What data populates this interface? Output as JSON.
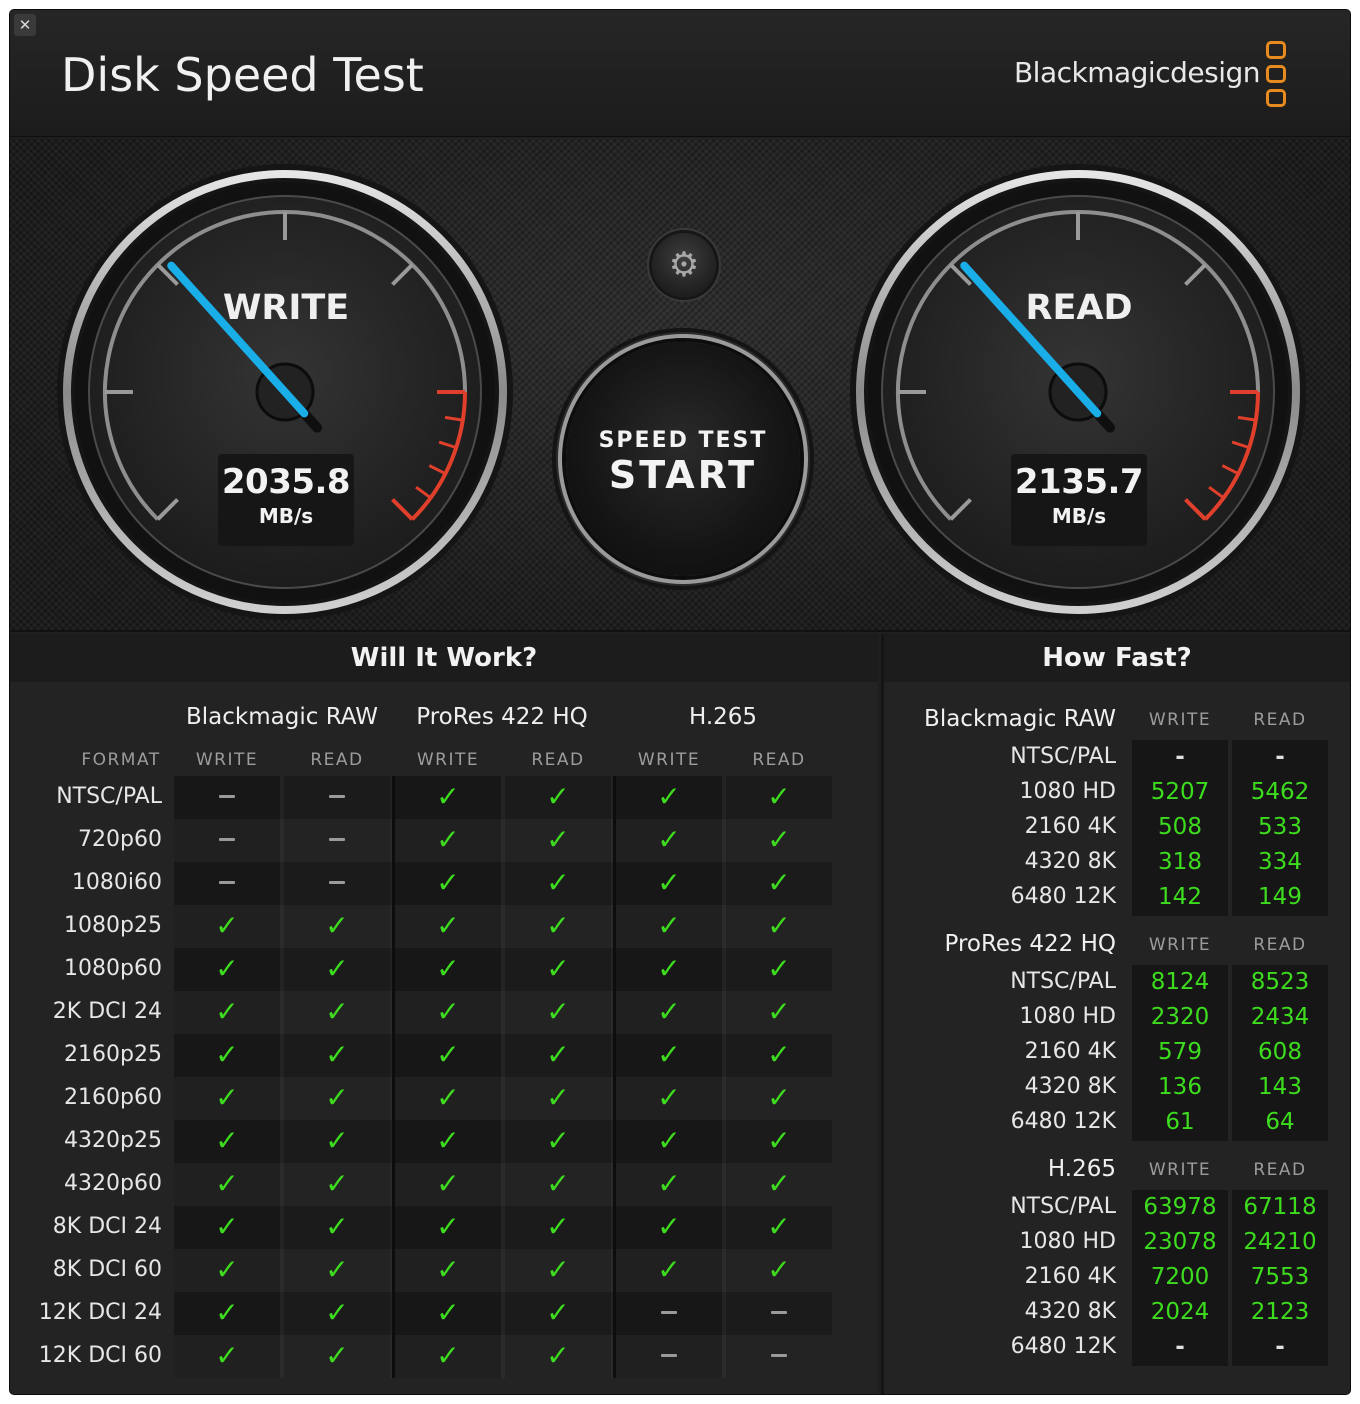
{
  "window": {
    "close_glyph": "✕",
    "title": "Disk Speed Test",
    "brand": "Blackmagicdesign",
    "brand_color": "#e88b1e"
  },
  "gauges": {
    "write": {
      "label": "WRITE",
      "value": "2035.8",
      "unit": "MB/s"
    },
    "read": {
      "label": "READ",
      "value": "2135.7",
      "unit": "MB/s"
    },
    "needle_color": "#1aaee8",
    "redline_color": "#e0402b"
  },
  "controls": {
    "settings_icon": "gear-icon",
    "settings_glyph": "⚙",
    "start_top": "SPEED TEST",
    "start_main": "START"
  },
  "will_it_work": {
    "title": "Will It Work?",
    "format_header": "FORMAT",
    "codecs": [
      "Blackmagic RAW",
      "ProRes 422 HQ",
      "H.265"
    ],
    "sub_headers": [
      "WRITE",
      "READ",
      "WRITE",
      "READ",
      "WRITE",
      "READ"
    ],
    "formats": [
      {
        "name": "NTSC/PAL",
        "marks": [
          "dash",
          "dash",
          "check",
          "check",
          "check",
          "check"
        ]
      },
      {
        "name": "720p60",
        "marks": [
          "dash",
          "dash",
          "check",
          "check",
          "check",
          "check"
        ]
      },
      {
        "name": "1080i60",
        "marks": [
          "dash",
          "dash",
          "check",
          "check",
          "check",
          "check"
        ]
      },
      {
        "name": "1080p25",
        "marks": [
          "check",
          "check",
          "check",
          "check",
          "check",
          "check"
        ]
      },
      {
        "name": "1080p60",
        "marks": [
          "check",
          "check",
          "check",
          "check",
          "check",
          "check"
        ]
      },
      {
        "name": "2K DCI 24",
        "marks": [
          "check",
          "check",
          "check",
          "check",
          "check",
          "check"
        ]
      },
      {
        "name": "2160p25",
        "marks": [
          "check",
          "check",
          "check",
          "check",
          "check",
          "check"
        ]
      },
      {
        "name": "2160p60",
        "marks": [
          "check",
          "check",
          "check",
          "check",
          "check",
          "check"
        ]
      },
      {
        "name": "4320p25",
        "marks": [
          "check",
          "check",
          "check",
          "check",
          "check",
          "check"
        ]
      },
      {
        "name": "4320p60",
        "marks": [
          "check",
          "check",
          "check",
          "check",
          "check",
          "check"
        ]
      },
      {
        "name": "8K DCI 24",
        "marks": [
          "check",
          "check",
          "check",
          "check",
          "check",
          "check"
        ]
      },
      {
        "name": "8K DCI 60",
        "marks": [
          "check",
          "check",
          "check",
          "check",
          "check",
          "check"
        ]
      },
      {
        "name": "12K DCI 24",
        "marks": [
          "check",
          "check",
          "check",
          "check",
          "dash",
          "dash"
        ]
      },
      {
        "name": "12K DCI 60",
        "marks": [
          "check",
          "check",
          "check",
          "check",
          "dash",
          "dash"
        ]
      }
    ],
    "check_glyph": "✓",
    "check_color": "#3ddc1e"
  },
  "how_fast": {
    "title": "How Fast?",
    "col_write": "WRITE",
    "col_read": "READ",
    "sections": [
      {
        "name": "Blackmagic RAW",
        "rows": [
          {
            "label": "NTSC/PAL",
            "write": "-",
            "read": "-"
          },
          {
            "label": "1080 HD",
            "write": "5207",
            "read": "5462"
          },
          {
            "label": "2160 4K",
            "write": "508",
            "read": "533"
          },
          {
            "label": "4320 8K",
            "write": "318",
            "read": "334"
          },
          {
            "label": "6480 12K",
            "write": "142",
            "read": "149"
          }
        ]
      },
      {
        "name": "ProRes 422 HQ",
        "rows": [
          {
            "label": "NTSC/PAL",
            "write": "8124",
            "read": "8523"
          },
          {
            "label": "1080 HD",
            "write": "2320",
            "read": "2434"
          },
          {
            "label": "2160 4K",
            "write": "579",
            "read": "608"
          },
          {
            "label": "4320 8K",
            "write": "136",
            "read": "143"
          },
          {
            "label": "6480 12K",
            "write": "61",
            "read": "64"
          }
        ]
      },
      {
        "name": "H.265",
        "rows": [
          {
            "label": "NTSC/PAL",
            "write": "63978",
            "read": "67118"
          },
          {
            "label": "1080 HD",
            "write": "23078",
            "read": "24210"
          },
          {
            "label": "2160 4K",
            "write": "7200",
            "read": "7553"
          },
          {
            "label": "4320 8K",
            "write": "2024",
            "read": "2123"
          },
          {
            "label": "6480 12K",
            "write": "-",
            "read": "-"
          }
        ]
      }
    ]
  }
}
